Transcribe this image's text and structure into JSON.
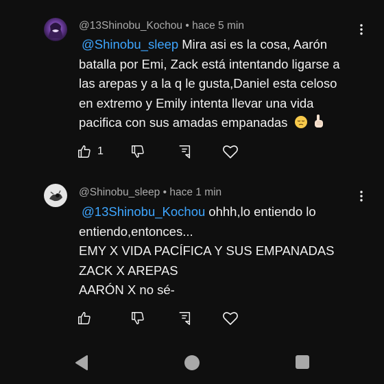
{
  "comments": [
    {
      "author": "@13Shinobu_Kochou",
      "separator": "•",
      "time": "hace 5 min",
      "mention": "@Shinobu_sleep",
      "lines": [
        "Mira asi es la cosa, Aarón",
        "batalla por Emi, Zack está intentando ligarse a",
        "las arepas y a la q le gusta,Daniel esta celoso",
        "en extremo y Emily intenta llevar una vida",
        "pacifica con sus amadas empanadas"
      ],
      "emojis": [
        "pensive-face",
        "index-pointing-up"
      ],
      "like_count": "1"
    },
    {
      "author": "@Shinobu_sleep",
      "separator": "•",
      "time": "hace 1 min",
      "mention": "@13Shinobu_Kochou",
      "lines": [
        "ohhh,lo entiendo lo",
        "entiendo,entonces...",
        "EMY X VIDA PACÍFICA Y SUS EMPANADAS",
        "ZACK X AREPAS",
        "AARÓN X no sé-"
      ],
      "like_count": ""
    }
  ],
  "icons": {
    "like": "thumbs-up-icon",
    "dislike": "thumbs-down-icon",
    "reply": "reply-icon",
    "heart": "heart-icon",
    "menu": "more-vert-icon",
    "nav_back": "back-triangle-icon",
    "nav_home": "home-circle-icon",
    "nav_recents": "recents-square-icon"
  },
  "colors": {
    "background": "#0f0f0f",
    "text": "#f1f1f1",
    "meta": "#aaaaaa",
    "mention": "#3ea6ff",
    "nav": "#a8a8a8"
  }
}
